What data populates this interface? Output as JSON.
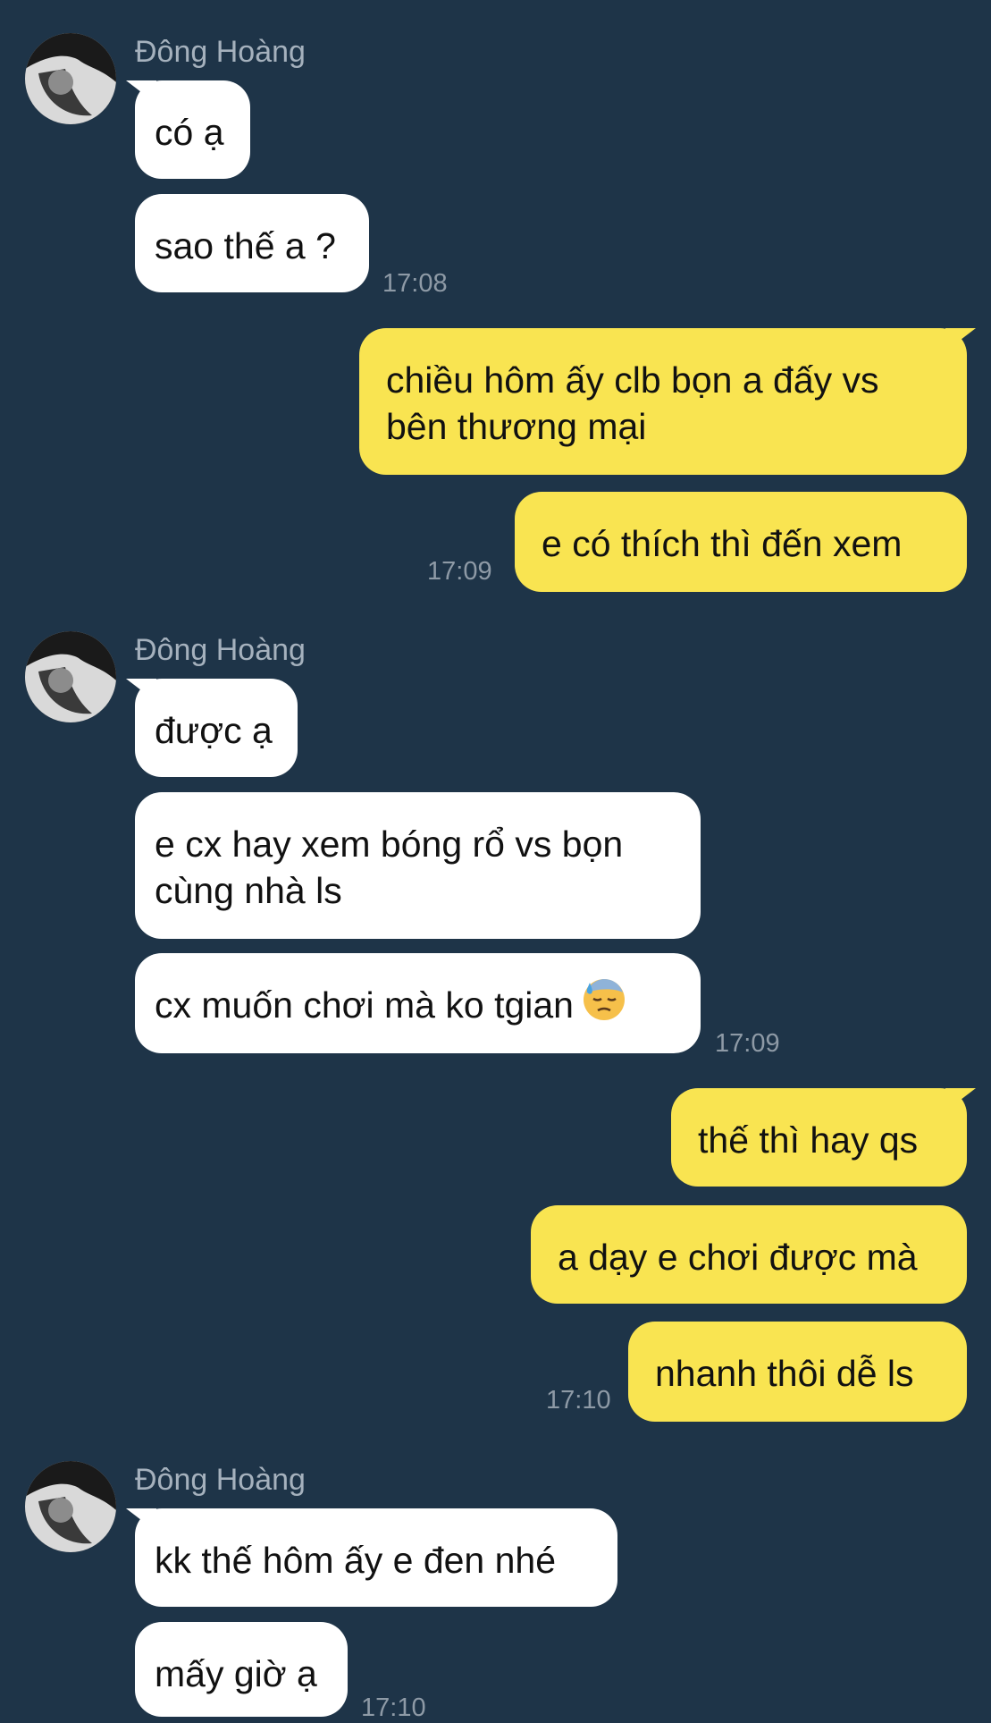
{
  "conversation": {
    "sender_name": "Đông Hoàng",
    "groups": [
      {
        "side": "in",
        "sender": "Đông Hoàng",
        "messages": [
          "có ạ",
          "sao thế a ?"
        ],
        "time": "17:08"
      },
      {
        "side": "out",
        "messages": [
          "chiều hôm ấy clb bọn a đấy vs bên thương mại",
          "e có thích thì đến xem"
        ],
        "time": "17:09"
      },
      {
        "side": "in",
        "sender": "Đông Hoàng",
        "messages": [
          "được ạ",
          "e cx hay xem bóng rổ vs bọn cùng nhà ls",
          "cx muốn chơi mà ko tgian"
        ],
        "emoji": "downcast-face-with-sweat-icon",
        "time": "17:09"
      },
      {
        "side": "out",
        "messages": [
          "thế thì hay qs",
          "a dạy e chơi được mà",
          "nhanh thôi dễ ls"
        ],
        "time": "17:10"
      },
      {
        "side": "in",
        "sender": "Đông Hoàng",
        "messages": [
          "kk thế hôm ấy e đen nhé",
          "mấy giờ ạ"
        ],
        "time": "17:10"
      }
    ]
  },
  "colors": {
    "background": "#1e3448",
    "incoming_bubble": "#ffffff",
    "outgoing_bubble": "#f9e451",
    "sender_name": "#a5b1bd",
    "timestamp": "#8e9aa6"
  }
}
